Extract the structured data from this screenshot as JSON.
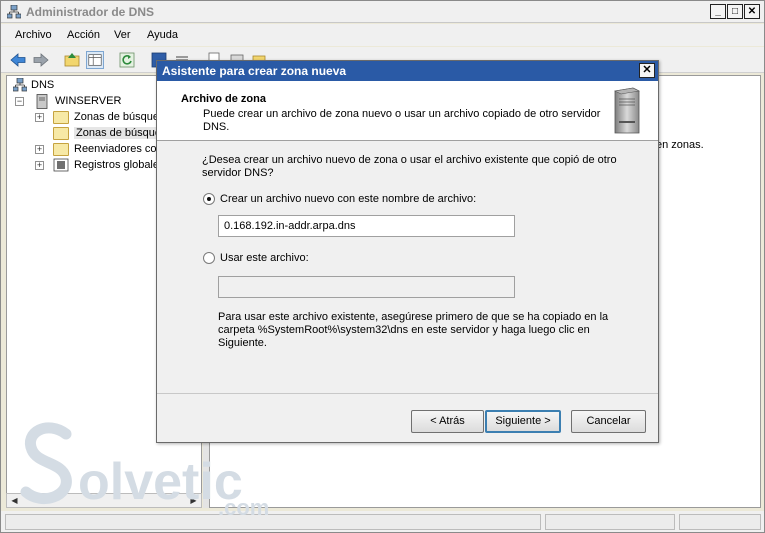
{
  "window": {
    "title": "Administrador de DNS"
  },
  "menu": [
    "Archivo",
    "Acción",
    "Ver",
    "Ayuda"
  ],
  "tree": {
    "root": "DNS",
    "server": "WINSERVER",
    "items": [
      "Zonas de búsqued",
      "Zonas de búsqued",
      "Reenviadores cond",
      "Registros globales"
    ]
  },
  "right_pane": {
    "text": "en zonas."
  },
  "dialog": {
    "title": "Asistente para crear zona nueva",
    "close": "✕",
    "header_title": "Archivo de zona",
    "header_subtitle": "Puede crear un archivo de zona nuevo o usar un archivo copiado de otro servidor DNS.",
    "question": "¿Desea crear un archivo nuevo de zona o usar el archivo existente que copió de otro servidor DNS?",
    "option_new_label": "Crear un archivo nuevo con este nombre de archivo:",
    "new_file_value": "0.168.192.in-addr.arpa.dns",
    "option_existing_label": "Usar este archivo:",
    "existing_file_value": "",
    "note": "Para usar este archivo existente, asegúrese primero de que se ha copiado en la carpeta %SystemRoot%\\system32\\dns en este servidor y haga luego clic en Siguiente.",
    "buttons": {
      "back": "< Atrás",
      "next": "Siguiente >",
      "cancel": "Cancelar"
    }
  },
  "watermark": {
    "brand": "olvetic",
    "tld": ".com"
  },
  "colors": {
    "dialog_title": "#2a5aa6",
    "folder": "#f7e9a6"
  }
}
